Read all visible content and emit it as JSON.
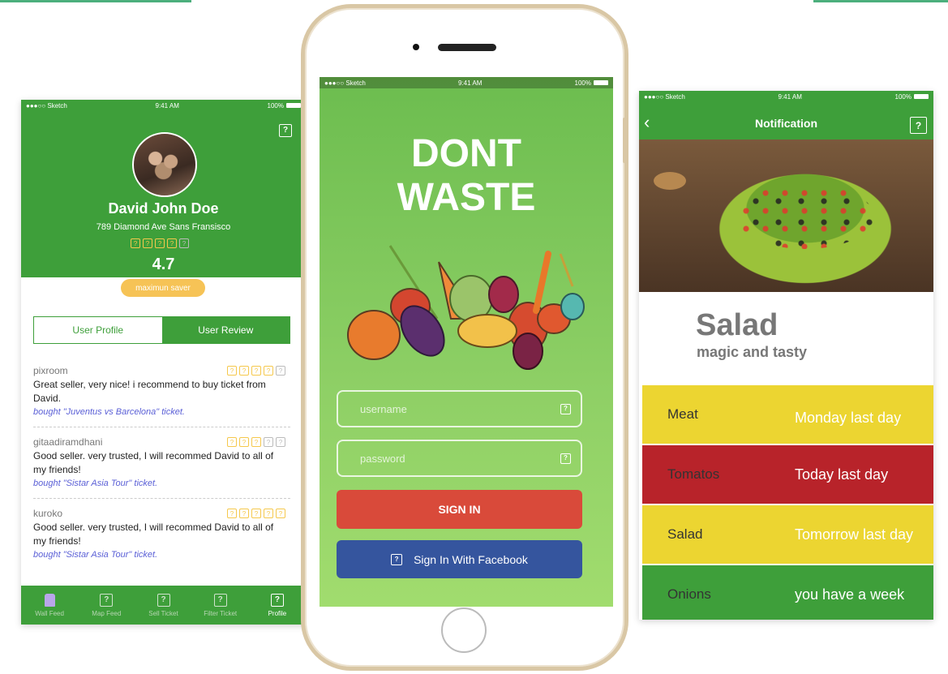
{
  "colors": {
    "green": "#3e9f3a",
    "red": "#d94a3a",
    "facebook": "#35559e",
    "yellow": "#ecd531",
    "darkred": "#b8232a",
    "star": "#f5c84c",
    "badge": "#f6c356"
  },
  "status": {
    "carrier": "●●●○○ Sketch",
    "time": "9:41 AM",
    "battery": "100%"
  },
  "profile": {
    "name": "David John Doe",
    "address": "789 Diamond Ave Sans Fransisco",
    "stars_filled": 4,
    "stars_total": 5,
    "rating": "4.7",
    "badge": "maximun saver",
    "tabs": [
      "User Profile",
      "User Review"
    ],
    "reviews": [
      {
        "user": "pixroom",
        "stars": 4,
        "text": "Great seller, very nice! i recommend to buy ticket from David.",
        "bought": "bought \"Juventus vs Barcelona\" ticket."
      },
      {
        "user": "gitaadiramdhani",
        "stars": 3,
        "text": "Good seller. very trusted, I will recommed David to all of my friends!",
        "bought": "bought \"Sistar Asia Tour\" ticket."
      },
      {
        "user": "kuroko",
        "stars": 5,
        "text": "Good seller. very trusted, I will recommed David to all of my friends!",
        "bought": "bought \"Sistar Asia Tour\" ticket."
      }
    ],
    "nav": [
      "Wall Feed",
      "Map Feed",
      "Sell Ticket",
      "Filter Ticket",
      "Profile"
    ]
  },
  "login": {
    "title_line1": "DONT",
    "title_line2": "WASTE",
    "username_placeholder": "username",
    "password_placeholder": "password",
    "signin": "SIGN IN",
    "facebook": "Sign In With Facebook"
  },
  "notification": {
    "title": "Notification",
    "food_name": "Salad",
    "food_sub": "magic and tasty",
    "rows": [
      {
        "label": "Meat",
        "value": "Monday last day"
      },
      {
        "label": "Tomatos",
        "value": "Today last day"
      },
      {
        "label": "Salad",
        "value": "Tomorrow last day"
      },
      {
        "label": "Onions",
        "value": "you have a week"
      }
    ]
  }
}
